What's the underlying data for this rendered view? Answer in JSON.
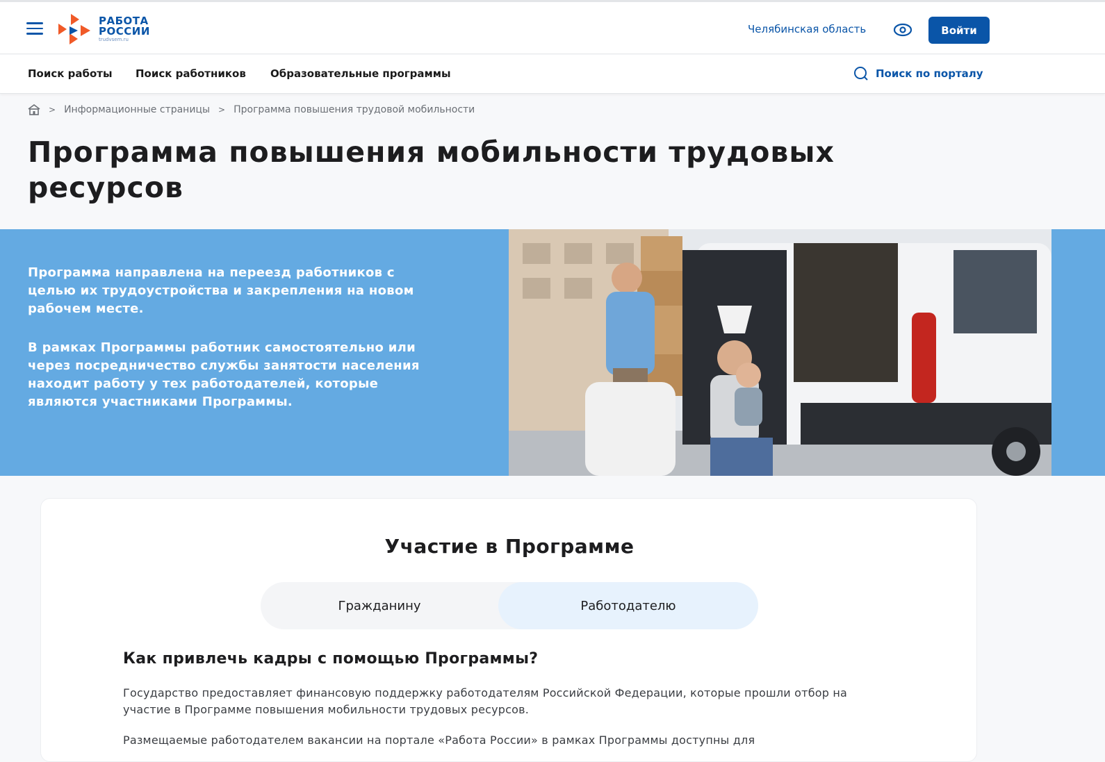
{
  "header": {
    "logo_line1": "РАБОТА",
    "logo_line2": "РОССИИ",
    "logo_domain": "trudvsem.ru",
    "region": "Челябинская область",
    "login_label": "Войти"
  },
  "nav": {
    "items": [
      {
        "label": "Поиск работы"
      },
      {
        "label": "Поиск работников"
      },
      {
        "label": "Образовательные программы"
      }
    ],
    "search_label": "Поиск по порталу"
  },
  "breadcrumb": {
    "items": [
      {
        "label": "Информационные страницы"
      },
      {
        "label": "Программа повышения трудовой мобильности"
      }
    ]
  },
  "page": {
    "title_line1": "Программа повышения мобильности трудовых",
    "title_line2": "ресурсов"
  },
  "hero": {
    "paragraph1": "Программа направлена на переезд работников с целью их трудоустройства и закрепления на новом рабочем месте.",
    "paragraph2": "В рамках Программы работник самостоятельно или через посредничество службы занятости населения находит работу у тех работодателей, которые являются участниками Программы."
  },
  "participation": {
    "title": "Участие в Программе",
    "tabs": [
      {
        "label": "Гражданину",
        "active": false
      },
      {
        "label": "Работодателю",
        "active": true
      }
    ],
    "heading": "Как привлечь кадры с помощью Программы?",
    "paragraph1": "Государство предоставляет финансовую поддержку работодателям Российской Федерации, которые прошли отбор на участие в Программе повышения мобильности трудовых ресурсов.",
    "paragraph2": "Размещаемые работодателем вакансии на портале «Работа России» в рамках Программы доступны для"
  },
  "colors": {
    "brand_blue": "#0a55a8",
    "hero_blue": "#64aae2",
    "logo_orange": "#f05a28",
    "active_tab": "#e7f2fd"
  },
  "icons": [
    "menu-icon",
    "logo-icon",
    "eye-icon",
    "search-icon",
    "home-icon"
  ]
}
